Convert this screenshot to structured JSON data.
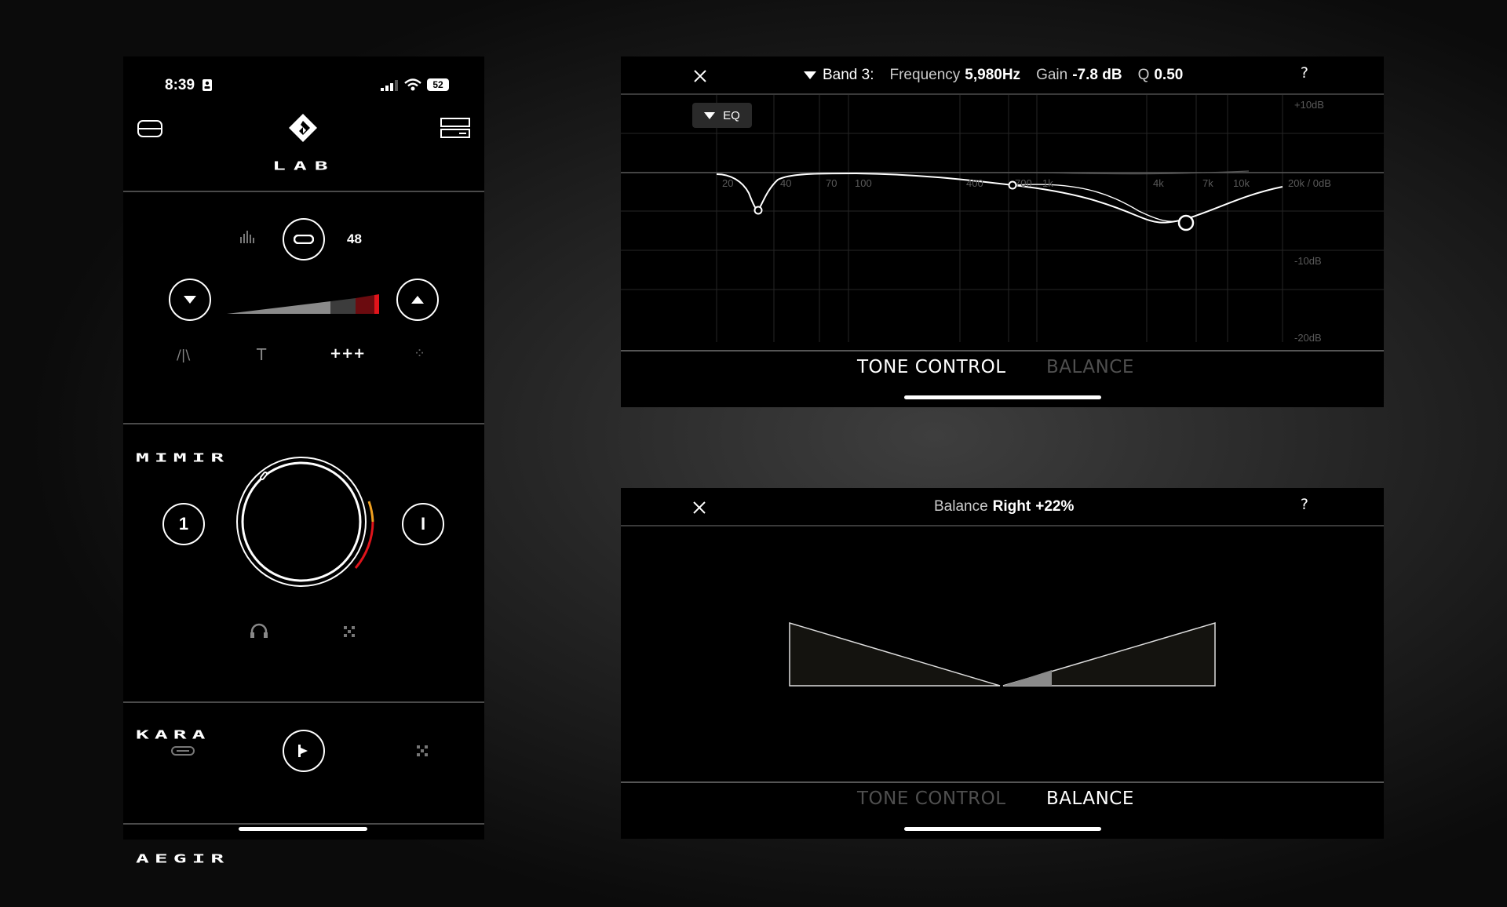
{
  "phone": {
    "status": {
      "time": "8:39",
      "battery": "52"
    },
    "header": {
      "logo": "LAB"
    },
    "mimir": {
      "volume_value": "48",
      "name": "MIMIR",
      "filter_labels": [
        "/|\\",
        "T",
        "+++",
        "⁘"
      ]
    },
    "kara": {
      "name": "KARA",
      "left_input": "1",
      "right_input": "I"
    },
    "aegir": {
      "name": "AEGIR"
    }
  },
  "eq_panel": {
    "band_label": "Band 3:",
    "freq_label": "Frequency",
    "freq_value": "5,980Hz",
    "gain_label": "Gain",
    "gain_value": "-7.8 dB",
    "q_label": "Q",
    "q_value": "0.50",
    "help": "?",
    "eq_button": "EQ",
    "freq_ticks": [
      "20",
      "40",
      "70",
      "100",
      "400",
      "700",
      "1k",
      "4k",
      "7k",
      "10k",
      "20k / 0dB"
    ],
    "db_ticks": [
      "+10dB",
      "-10dB",
      "-20dB"
    ],
    "tabs": {
      "tone": "TONE CONTROL",
      "balance": "BALANCE"
    }
  },
  "balance_panel": {
    "label": "Balance",
    "side": "Right",
    "value": "+22%",
    "help": "?",
    "tabs": {
      "tone": "TONE CONTROL",
      "balance": "BALANCE"
    }
  },
  "colors": {
    "accent_red": "#e0141b",
    "accent_orange": "#f0a020",
    "dark_red": "#6b0b0f"
  }
}
